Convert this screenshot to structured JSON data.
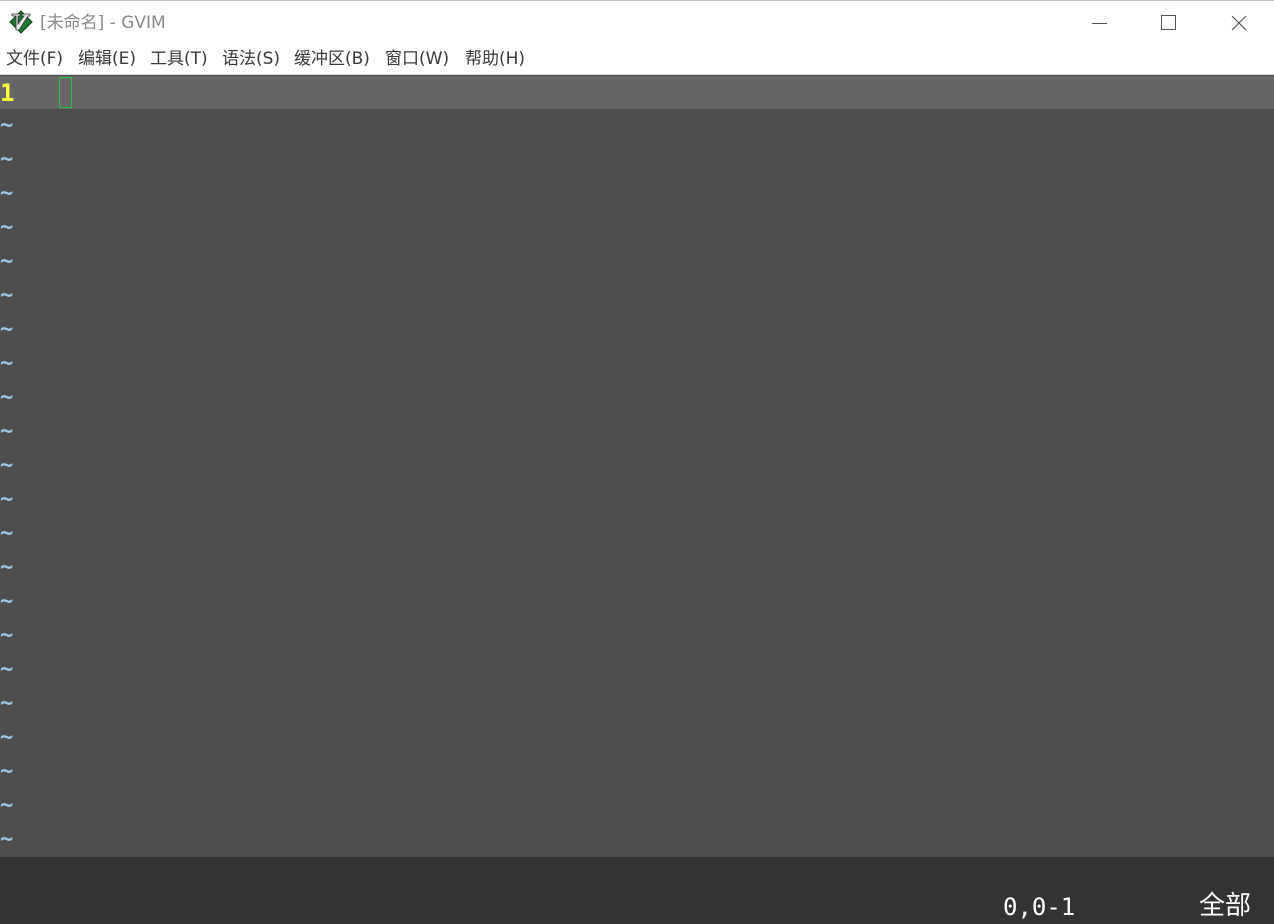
{
  "window": {
    "title": "[未命名] - GVIM",
    "app_icon": "vim-icon"
  },
  "titlebar_buttons": {
    "minimize_icon": "minimize-icon",
    "maximize_icon": "maximize-icon",
    "close_icon": "close-icon"
  },
  "menu": {
    "items": [
      {
        "label": "文件(F)"
      },
      {
        "label": "编辑(E)"
      },
      {
        "label": "工具(T)"
      },
      {
        "label": "语法(S)"
      },
      {
        "label": "缓冲区(B)"
      },
      {
        "label": "窗口(W)"
      },
      {
        "label": "帮助(H)"
      }
    ]
  },
  "editor": {
    "current_line_number": "1",
    "filler_marker": "~",
    "filler_line_count": 22,
    "colors": {
      "background": "#4e4e4e",
      "cursorline": "#666666",
      "line_number": "#ffff3a",
      "filler": "#9ac8e6",
      "cursor": "#28c23a"
    }
  },
  "statusline": {
    "ruler": "0,0-1",
    "position": "全部"
  }
}
